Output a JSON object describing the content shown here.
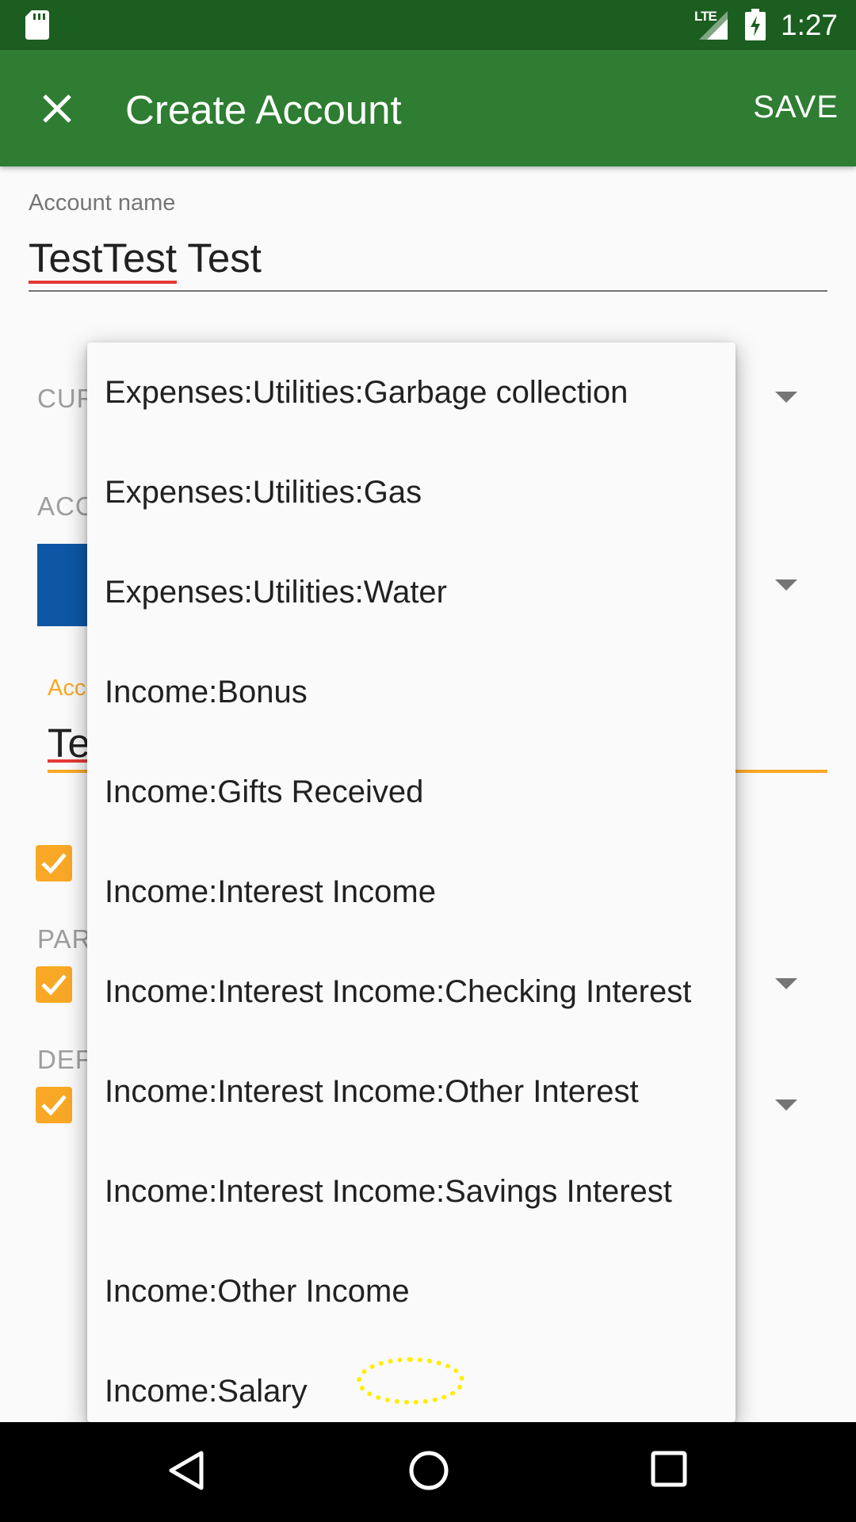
{
  "status_bar": {
    "time": "1:27",
    "network": "LTE"
  },
  "toolbar": {
    "title": "Create Account",
    "save_label": "SAVE"
  },
  "form": {
    "account_name_label": "Account name",
    "account_name_value_part1": "TestTest",
    "account_name_value_part2": " Test",
    "currency_label_partial": "CUR",
    "account_color_label_partial": "ACC",
    "account_color": "#0d57a5",
    "description_label_partial": "Acc",
    "description_value_partial": "Te",
    "parent_label_partial": "PAR",
    "default_label_partial": "DEF"
  },
  "popup": {
    "items": [
      "Expenses:Utilities:Garbage collection",
      "Expenses:Utilities:Gas",
      "Expenses:Utilities:Water",
      "Income:Bonus",
      "Income:Gifts Received",
      "Income:Interest Income",
      "Income:Interest Income:Checking Interest",
      "Income:Interest Income:Other Interest",
      "Income:Interest Income:Savings Interest",
      "Income:Other Income",
      "Income:Salary"
    ]
  },
  "colors": {
    "primary": "#2e7d32",
    "primary_dark": "#1b5e20",
    "accent": "#f9a825"
  }
}
